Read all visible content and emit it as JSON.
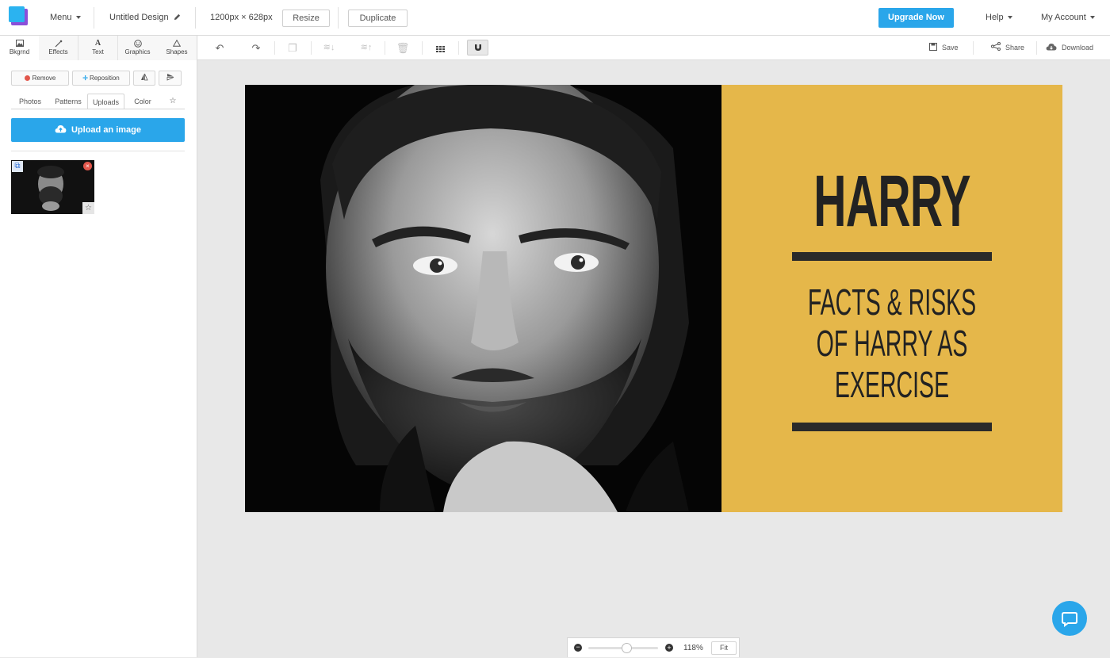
{
  "topbar": {
    "menu_label": "Menu",
    "design_title": "Untitled Design",
    "dimensions": "1200px × 628px",
    "resize_label": "Resize",
    "duplicate_label": "Duplicate",
    "upgrade_label": "Upgrade Now",
    "help_label": "Help",
    "account_label": "My Account"
  },
  "left_tabs": [
    {
      "label": "Bkgrnd",
      "icon": "image-icon"
    },
    {
      "label": "Effects",
      "icon": "magic-wand-icon"
    },
    {
      "label": "Text",
      "icon": "text-icon"
    },
    {
      "label": "Graphics",
      "icon": "smiley-icon"
    },
    {
      "label": "Shapes",
      "icon": "triangle-icon"
    }
  ],
  "bg_actions": {
    "remove_label": "Remove",
    "reposition_label": "Reposition"
  },
  "sub_tabs": [
    "Photos",
    "Patterns",
    "Uploads",
    "Color"
  ],
  "upload_label": "Upload an image",
  "toolbar": {
    "save_label": "Save",
    "share_label": "Share",
    "download_label": "Download"
  },
  "design": {
    "headline": "HARRY",
    "subtitle_lines": [
      "FACTS & RISKS",
      "OF HARRY AS",
      "EXERCISE"
    ],
    "panel_color": "#e5b74a"
  },
  "zoom": {
    "level_label": "118%",
    "fit_label": "Fit",
    "slider_fraction": 0.55
  },
  "colors": {
    "accent": "#2aa6ea",
    "logo_front": "#2bb3f0",
    "logo_back": "#8b4fd9"
  }
}
